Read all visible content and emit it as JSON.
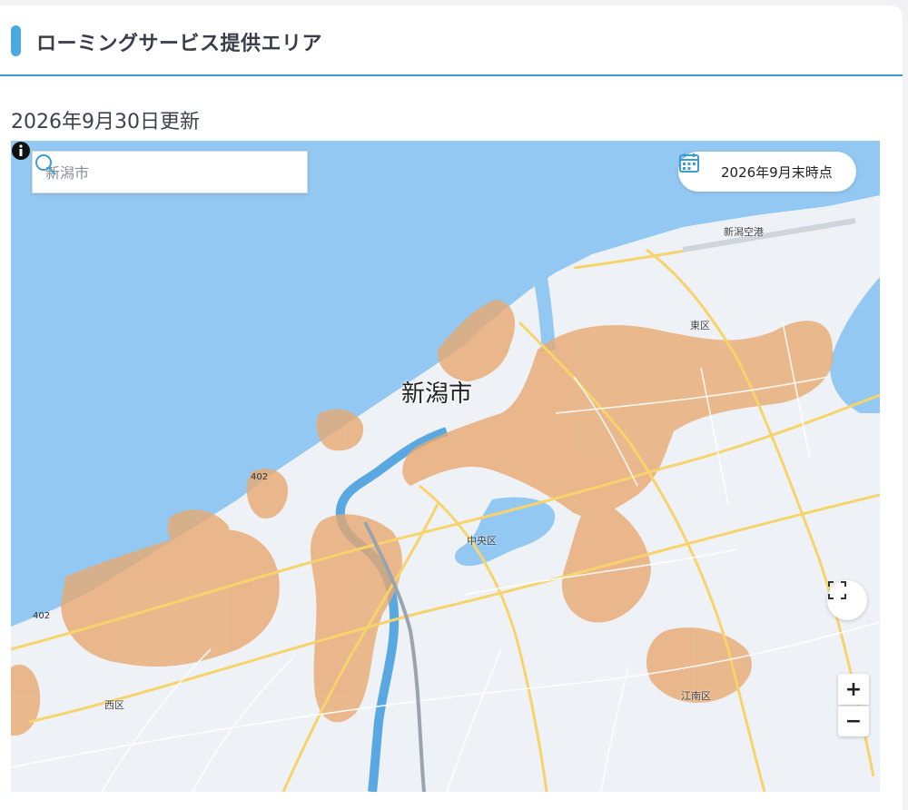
{
  "section": {
    "title": "ローミングサービス提供エリア"
  },
  "updated_date": "2026年9月30日更新",
  "map": {
    "search": {
      "placeholder": "新潟市"
    },
    "date_badge": "2026年9月末時点",
    "labels": {
      "city": "新潟市",
      "airport": "新潟空港",
      "ward_east": "東区",
      "ward_central": "中央区",
      "ward_west": "西区",
      "ward_konan": "江南区",
      "route_402_a": "402",
      "route_402_b": "402"
    },
    "controls": {
      "zoom_in": "+",
      "zoom_out": "−"
    },
    "colors": {
      "water": "#93c8f3",
      "land": "#eef1f5",
      "coverage": "#e9a86f",
      "major_road": "#f7d46b",
      "river": "#5aa8e2"
    }
  }
}
